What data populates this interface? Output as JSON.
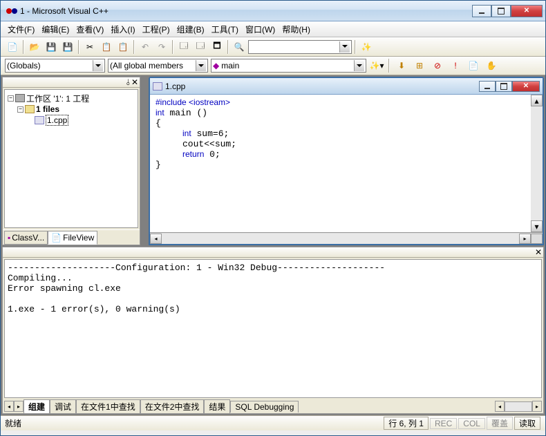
{
  "title": "1 - Microsoft Visual C++",
  "menu": {
    "file": "文件(F)",
    "edit": "编辑(E)",
    "view": "查看(V)",
    "insert": "插入(I)",
    "project": "工程(P)",
    "build": "组建(B)",
    "tool": "工具(T)",
    "window": "窗口(W)",
    "help": "帮助(H)"
  },
  "combos": {
    "scope": "(Globals)",
    "members": "(All global members",
    "func": "main"
  },
  "tree": {
    "workspace": "工作区 '1': 1 工程",
    "project": "1 files",
    "file": "1.cpp"
  },
  "side_tabs": {
    "classview": "ClassV...",
    "fileview": "FileView"
  },
  "editor": {
    "filename": "1.cpp",
    "code_lines": [
      {
        "t": "pp",
        "v": "#include <iostream>"
      },
      {
        "t": "mix",
        "v": "int main ()"
      },
      {
        "t": "",
        "v": "{"
      },
      {
        "t": "mix",
        "v": "     int sum=6;"
      },
      {
        "t": "",
        "v": "     cout<<sum;"
      },
      {
        "t": "mix",
        "v": "     return 0;"
      },
      {
        "t": "",
        "v": "}"
      }
    ]
  },
  "output": {
    "text": "--------------------Configuration: 1 - Win32 Debug--------------------\nCompiling...\nError spawning cl.exe\n\n1.exe - 1 error(s), 0 warning(s)",
    "tabs": {
      "build": "组建",
      "debug": "调试",
      "find1": "在文件1中查找",
      "find2": "在文件2中查找",
      "result": "结果",
      "sql": "SQL Debugging"
    }
  },
  "status": {
    "ready": "就绪",
    "pos": "行 6, 列 1",
    "rec": "REC",
    "col": "COL",
    "ovr": "覆盖",
    "read": "读取"
  }
}
